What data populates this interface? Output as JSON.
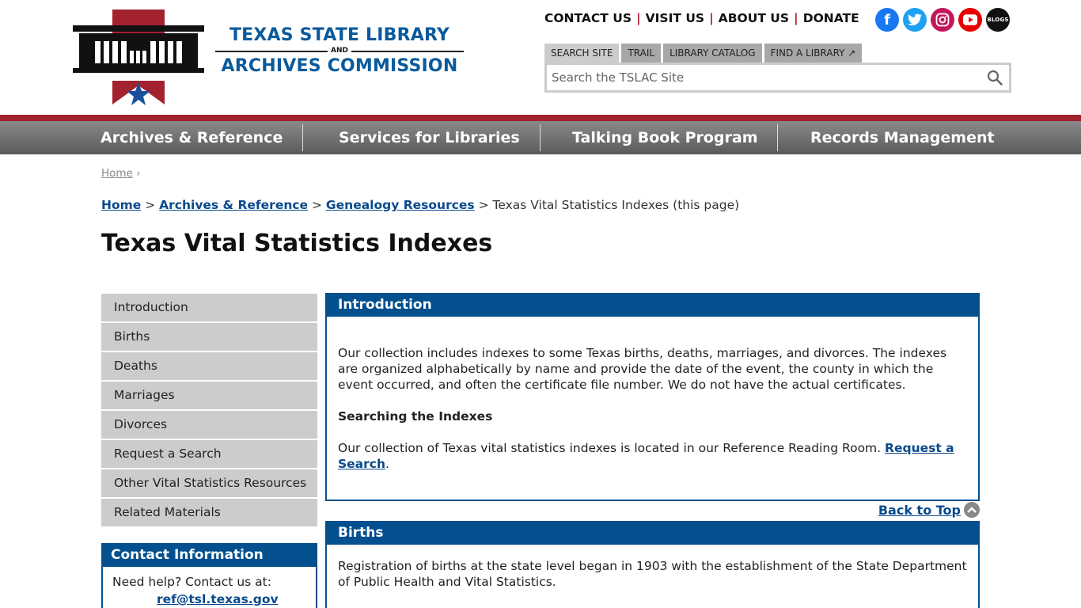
{
  "header": {
    "logo_line1": "TEXAS STATE LIBRARY",
    "logo_and": "AND",
    "logo_line2": "ARCHIVES COMMISSION",
    "top_links": [
      "CONTACT US",
      "VISIT US",
      "ABOUT US",
      "DONATE"
    ],
    "social": [
      {
        "name": "facebook",
        "glyph": "f"
      },
      {
        "name": "twitter",
        "glyph": "🐦"
      },
      {
        "name": "instagram",
        "glyph": "◎"
      },
      {
        "name": "youtube",
        "glyph": "▶"
      },
      {
        "name": "blogs",
        "glyph": "BLOGS"
      }
    ],
    "search_tabs": [
      "SEARCH SITE",
      "TRAIL",
      "LIBRARY CATALOG",
      "FIND A LIBRARY ↗"
    ],
    "search_placeholder": "Search the TSLAC Site"
  },
  "nav": [
    "Archives & Reference",
    "Services for Libraries",
    "Talking Book Program",
    "Records Management"
  ],
  "breadcrumb_small": {
    "home": "Home",
    "sep": "›"
  },
  "breadcrumb": {
    "items": [
      "Home",
      "Archives & Reference",
      "Genealogy Resources"
    ],
    "current": "Texas Vital Statistics Indexes (this page)"
  },
  "page_title": "Texas Vital Statistics Indexes",
  "sidebar": [
    "Introduction",
    "Births",
    "Deaths",
    "Marriages",
    "Divorces",
    "Request a Search",
    "Other Vital Statistics Resources",
    "Related Materials"
  ],
  "contact": {
    "title": "Contact Information",
    "text": "Need help? Contact us at:",
    "email": "ref@tsl.texas.gov"
  },
  "intro": {
    "title": "Introduction",
    "para1": "Our collection includes indexes to some Texas births, deaths, marriages, and divorces. The indexes are organized alphabetically by name and provide the date of the event, the county in which the event occurred, and often the certificate file number. We do not have the actual certificates.",
    "subhead": "Searching the Indexes",
    "para2": "Our collection of Texas vital statistics indexes is located in our Reference Reading Room.",
    "link": "Request a Search",
    "para2_end": "."
  },
  "back_to_top": "Back to Top",
  "births": {
    "title": "Births",
    "para1": "Registration of births at the state level began in 1903 with the establishment of the State Department of Public Health and Vital Statistics."
  },
  "colors": {
    "blue": "#04508f",
    "red": "#a3222f",
    "link": "#0a4a8c",
    "grey": "#cccccc"
  }
}
